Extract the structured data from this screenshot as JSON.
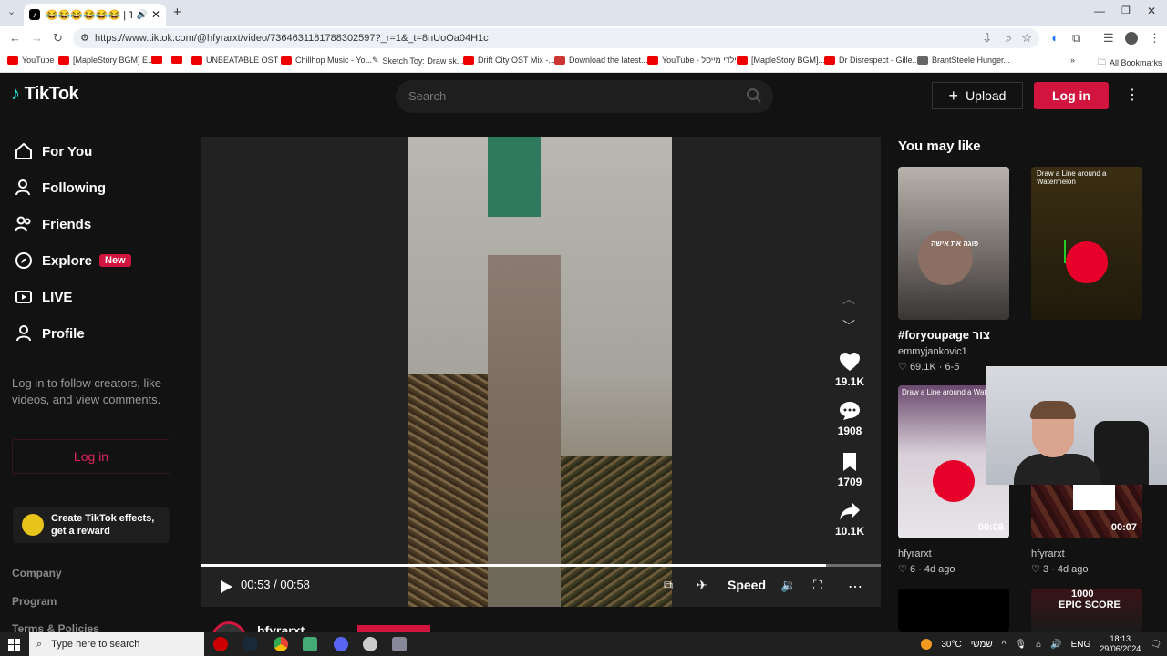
{
  "browser": {
    "tab_title": "😂😂😂😂😂😂 | TikTok",
    "url": "https://www.tiktok.com/@hfyrarxt/video/7364631181788302597?_r=1&_t=8nUoOa04H1c",
    "bookmarks": [
      {
        "label": "YouTube",
        "icon": "youtube-icon"
      },
      {
        "label": "[MapleStory BGM] E...",
        "icon": "youtube-icon"
      },
      {
        "label": "",
        "icon": "youtube-icon"
      },
      {
        "label": "",
        "icon": "youtube-icon"
      },
      {
        "label": "UNBEATABLE OST -...",
        "icon": "youtube-icon"
      },
      {
        "label": "Chillhop Music - Yo...",
        "icon": "youtube-icon"
      },
      {
        "label": "Sketch Toy: Draw sk...",
        "icon": "sketch-icon"
      },
      {
        "label": "Drift City OST Mix -...",
        "icon": "youtube-icon"
      },
      {
        "label": "Download the latest...",
        "icon": "download-icon"
      },
      {
        "label": "YouTube - ילדי מייסל",
        "icon": "youtube-icon"
      },
      {
        "label": "[MapleStory BGM]...",
        "icon": "youtube-icon"
      },
      {
        "label": "Dr Disrespect - Gille...",
        "icon": "youtube-icon"
      },
      {
        "label": "BrantSteele Hunger...",
        "icon": "brantsteele-icon"
      }
    ],
    "all_bookmarks": "All Bookmarks"
  },
  "tiktok": {
    "logo": "TikTok",
    "search_placeholder": "Search",
    "upload": "Upload",
    "login": "Log in",
    "nav": [
      {
        "label": "For You",
        "icon": "home-icon"
      },
      {
        "label": "Following",
        "icon": "following-icon"
      },
      {
        "label": "Friends",
        "icon": "friends-icon"
      },
      {
        "label": "Explore",
        "icon": "compass-icon",
        "badge": "New"
      },
      {
        "label": "LIVE",
        "icon": "live-icon"
      },
      {
        "label": "Profile",
        "icon": "profile-icon"
      }
    ],
    "login_prompt": "Log in to follow creators, like videos, and view comments.",
    "login_side": "Log in",
    "effects": "Create TikTok effects, get a reward",
    "footer": [
      "Company",
      "Program",
      "Terms & Policies"
    ]
  },
  "player": {
    "time": "00:53 / 00:58",
    "progress": 0.92,
    "speed": "Speed",
    "likes": "19.1K",
    "comments": "1908",
    "saves": "1709",
    "shares": "10.1K",
    "author": "hfyrarxt"
  },
  "rail": {
    "title": "You may like",
    "cards": [
      {
        "caption": "#foryoupage צור",
        "author": "emmyjankovic1",
        "likes": "69.1K",
        "date": "6-5",
        "overlay": "פוגה את אישה"
      },
      {
        "overlay": "Draw a Line around a Watermelon"
      },
      {
        "overlay": "Draw a Line around a Water",
        "duration": "00:08",
        "author": "hfyrarxt",
        "likes": "6",
        "date": "4d ago"
      },
      {
        "duration": "00:07",
        "author": "hfyrarxt",
        "likes": "3",
        "date": "4d ago"
      },
      {},
      {
        "overlay": "EPIC SCORE",
        "overlay_top": "1000"
      }
    ]
  },
  "taskbar": {
    "search": "Type here to search",
    "weather": "30°C",
    "weather_day": "שמשי",
    "lang": "ENG",
    "time": "18:13",
    "date": "29/06/2024"
  },
  "colors": {
    "accent": "#d1153f",
    "bg": "#121212"
  }
}
